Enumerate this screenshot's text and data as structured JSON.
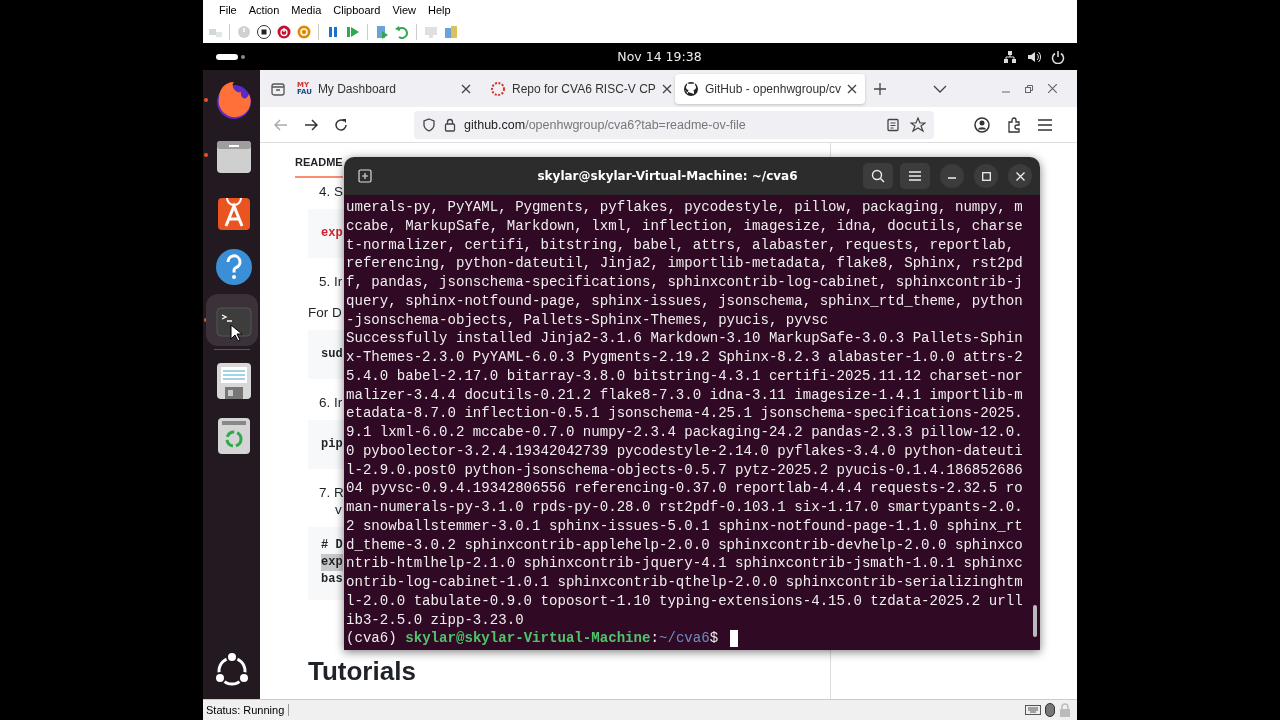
{
  "vm_window": {
    "menu": [
      "File",
      "Action",
      "Media",
      "Clipboard",
      "View",
      "Help"
    ],
    "toolbar": [
      {
        "kind": "ctrl-alt-del",
        "disabled": true
      },
      {
        "kind": "start",
        "disabled": true
      },
      {
        "kind": "turn-off",
        "disabled": false
      },
      {
        "kind": "shut-down",
        "disabled": false
      },
      {
        "kind": "save",
        "disabled": false
      },
      {
        "kind": "pause",
        "disabled": false
      },
      {
        "kind": "resume",
        "disabled": false
      },
      {
        "kind": "checkpoint",
        "disabled": false
      },
      {
        "kind": "revert",
        "disabled": false
      },
      {
        "kind": "enhanced-session",
        "disabled": true
      },
      {
        "kind": "share",
        "disabled": false
      }
    ],
    "status": "Status: Running"
  },
  "top_bar": {
    "clock": "Nov 14  19:38"
  },
  "dock": {
    "items": [
      {
        "kind": "browser",
        "running": true,
        "selected": false
      },
      {
        "kind": "files",
        "running": true,
        "selected": false
      },
      {
        "kind": "app-center",
        "running": false,
        "selected": false
      },
      {
        "kind": "help",
        "running": false,
        "selected": false
      },
      {
        "kind": "terminal",
        "running": true,
        "selected": true
      },
      {
        "kind": "editor",
        "running": false,
        "selected": false
      },
      {
        "kind": "trash",
        "running": false,
        "selected": false
      }
    ]
  },
  "browser": {
    "tabs": [
      {
        "kind": "fau",
        "logo_text": [
          "MY",
          "FAU"
        ],
        "title": "My Dashboard",
        "selected": false
      },
      {
        "kind": "loading",
        "title": "Repo for CVA6 RISC-V CP",
        "selected": false
      },
      {
        "kind": "github",
        "title": "GitHub - openhwgroup/cv",
        "selected": true
      }
    ],
    "address": {
      "host": "github.com",
      "path": "/openhwgroup/cva6?tab=readme-ov-file"
    },
    "page": [
      {
        "kind": "tab",
        "text": "README"
      },
      {
        "kind": "step",
        "text": "4. S"
      },
      {
        "kind": "code",
        "lines": [
          {
            "text": "exp",
            "highlight": false
          }
        ],
        "color": "#cf222e"
      },
      {
        "kind": "step",
        "text": "5. Ir"
      },
      {
        "kind": "para",
        "text": "For D"
      },
      {
        "kind": "code",
        "lines": [
          {
            "text": "sud",
            "highlight": false
          }
        ],
        "color": "#1f2328"
      },
      {
        "kind": "step",
        "text": "6. Ir"
      },
      {
        "kind": "code",
        "lines": [
          {
            "text": "pip",
            "highlight": false
          }
        ],
        "color": "#1f2328"
      },
      {
        "kind": "step",
        "text": "7. R"
      },
      {
        "kind": "cont",
        "text": "v"
      },
      {
        "kind": "code",
        "lines": [
          {
            "text": "# D",
            "highlight": false
          },
          {
            "text": "exp",
            "highlight": true
          },
          {
            "text": "bas",
            "highlight": false
          }
        ],
        "color": "#1f2328"
      },
      {
        "kind": "heading",
        "text": "Tutorials"
      }
    ]
  },
  "terminal": {
    "title": "skylar@skylar-Virtual-Machine: ~/cva6",
    "lines": [
      "umerals-py, PyYAML, Pygments, pyflakes, pycodestyle, pillow, packaging, numpy, m",
      "ccabe, MarkupSafe, Markdown, lxml, inflection, imagesize, idna, docutils, charse",
      "t-normalizer, certifi, bitstring, babel, attrs, alabaster, requests, reportlab,",
      "referencing, python-dateutil, Jinja2, importlib-metadata, flake8, Sphinx, rst2pd",
      "f, pandas, jsonschema-specifications, sphinxcontrib-log-cabinet, sphinxcontrib-j",
      "query, sphinx-notfound-page, sphinx-issues, jsonschema, sphinx_rtd_theme, python",
      "-jsonschema-objects, Pallets-Sphinx-Themes, pyucis, pyvsc",
      "Successfully installed Jinja2-3.1.6 Markdown-3.10 MarkupSafe-3.0.3 Pallets-Sphin",
      "x-Themes-2.3.0 PyYAML-6.0.3 Pygments-2.19.2 Sphinx-8.2.3 alabaster-1.0.0 attrs-2",
      "5.4.0 babel-2.17.0 bitarray-3.8.0 bitstring-4.3.1 certifi-2025.11.12 charset-nor",
      "malizer-3.4.4 docutils-0.21.2 flake8-7.3.0 idna-3.11 imagesize-1.4.1 importlib-m",
      "etadata-8.7.0 inflection-0.5.1 jsonschema-4.25.1 jsonschema-specifications-2025.",
      "9.1 lxml-6.0.2 mccabe-0.7.0 numpy-2.3.4 packaging-24.2 pandas-2.3.3 pillow-12.0.",
      "0 pyboolector-3.2.4.19342042739 pycodestyle-2.14.0 pyflakes-3.4.0 python-dateuti",
      "l-2.9.0.post0 python-jsonschema-objects-0.5.7 pytz-2025.2 pyucis-0.1.4.186852686",
      "04 pyvsc-0.9.4.19342806556 referencing-0.37.0 reportlab-4.4.4 requests-2.32.5 ro",
      "man-numerals-py-3.1.0 rpds-py-0.28.0 rst2pdf-0.103.1 six-1.17.0 smartypants-2.0.",
      "2 snowballstemmer-3.0.1 sphinx-issues-5.0.1 sphinx-notfound-page-1.1.0 sphinx_rt",
      "d_theme-3.0.2 sphinxcontrib-applehelp-2.0.0 sphinxcontrib-devhelp-2.0.0 sphinxco",
      "ntrib-htmlhelp-2.1.0 sphinxcontrib-jquery-4.1 sphinxcontrib-jsmath-1.0.1 sphinxc",
      "ontrib-log-cabinet-1.0.1 sphinxcontrib-qthelp-2.0.0 sphinxcontrib-serializinghtm",
      "l-2.0.0 tabulate-0.9.0 toposort-1.10 typing-extensions-4.15.0 tzdata-2025.2 urll",
      "ib3-2.5.0 zipp-3.23.0"
    ],
    "prompt": {
      "env": "(cva6) ",
      "user_host": "skylar@skylar-Virtual-Machine",
      "separator": ":",
      "path": "~/cva6",
      "symbol": "$ "
    }
  }
}
